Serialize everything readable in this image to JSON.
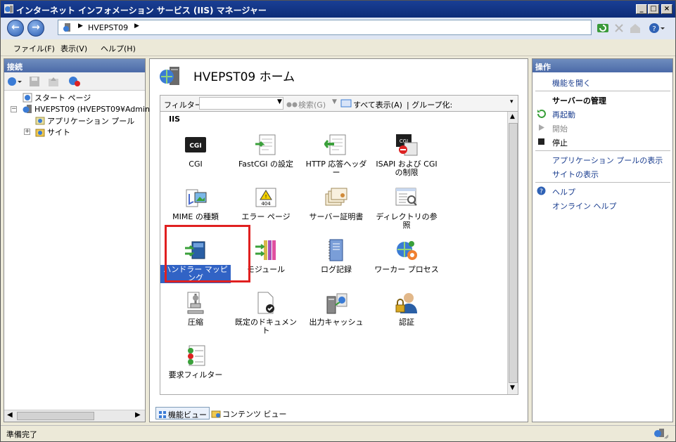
{
  "window": {
    "title": "インターネット インフォメーション サービス (IIS) マネージャー"
  },
  "nav": {
    "breadcrumb": "HVEPST09",
    "back_label": "←",
    "forward_label": "→"
  },
  "menu": [
    "ファイル(F)",
    "表示(V)",
    "ヘルプ(H)"
  ],
  "left": {
    "header": "接続",
    "tree": [
      {
        "label": "スタート ページ"
      },
      {
        "label": "HVEPST09 (HVEPST09¥Admin"
      },
      {
        "label": "アプリケーション プール"
      },
      {
        "label": "サイト"
      }
    ]
  },
  "center": {
    "title": "HVEPST09 ホーム",
    "filter_label": "フィルター:",
    "search_label": "検索(G)",
    "show_all_label": "すべて表示(A)",
    "group_label": "| グループ化:",
    "section": "IIS",
    "features": [
      {
        "label": "CGI",
        "icon": "cgi-icon"
      },
      {
        "label": "FastCGI の設定",
        "icon": "fastcgi-icon"
      },
      {
        "label": "HTTP 応答ヘッダー",
        "icon": "http-headers-icon"
      },
      {
        "label": "ISAPI および CGI の制限",
        "icon": "isapi-cgi-restrictions-icon"
      },
      {
        "label": "MIME の種類",
        "icon": "mime-types-icon"
      },
      {
        "label": "エラー ページ",
        "icon": "error-pages-icon"
      },
      {
        "label": "サーバー証明書",
        "icon": "server-certificates-icon"
      },
      {
        "label": "ディレクトリの参照",
        "icon": "directory-browsing-icon"
      },
      {
        "label": "ハンドラー マッピング",
        "icon": "handler-mappings-icon"
      },
      {
        "label": "モジュール",
        "icon": "modules-icon"
      },
      {
        "label": "ログ記録",
        "icon": "logging-icon"
      },
      {
        "label": "ワーカー プロセス",
        "icon": "worker-processes-icon"
      },
      {
        "label": "圧縮",
        "icon": "compression-icon"
      },
      {
        "label": "既定のドキュメント",
        "icon": "default-document-icon"
      },
      {
        "label": "出力キャッシュ",
        "icon": "output-caching-icon"
      },
      {
        "label": "認証",
        "icon": "authentication-icon"
      },
      {
        "label": "要求フィルター",
        "icon": "request-filtering-icon"
      }
    ],
    "view_tabs": {
      "features": "機能ビュー",
      "content": "コンテンツ ビュー"
    }
  },
  "right": {
    "header": "操作",
    "open_feature": "機能を開く",
    "manage_server": "サーバーの管理",
    "restart": "再起動",
    "start": "開始",
    "stop": "停止",
    "view_app_pools": "アプリケーション プールの表示",
    "view_sites": "サイトの表示",
    "help": "ヘルプ",
    "online_help": "オンライン ヘルプ"
  },
  "status": {
    "text": "準備完了"
  },
  "colors": {
    "selection": "#3163c5",
    "highlight_box": "#e02020",
    "title_bar": "#0d2c78"
  }
}
